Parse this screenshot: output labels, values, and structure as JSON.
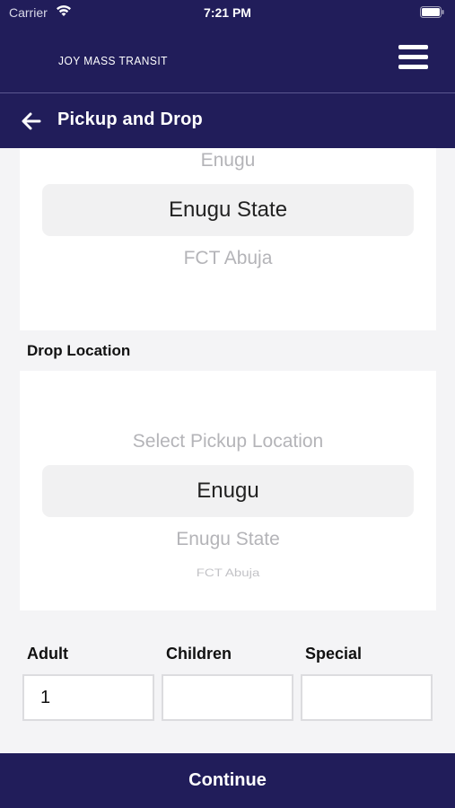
{
  "status_bar": {
    "carrier": "Carrier",
    "time": "7:21 PM",
    "wifi_icon": "wifi-icon",
    "battery_icon": "battery-icon"
  },
  "header": {
    "brand": "JOY MASS TRANSIT",
    "menu_icon": "hamburger-menu-icon",
    "title": "Pickup and Drop",
    "back_icon": "arrow-left-icon"
  },
  "pickup_picker": {
    "options_above": [
      "Enugu"
    ],
    "selected": "Enugu State",
    "options_below": [
      "FCT Abuja"
    ]
  },
  "drop": {
    "label": "Drop Location",
    "options_above": [
      "Select Pickup Location"
    ],
    "selected": "Enugu",
    "options_below": [
      "Enugu State",
      "FCT Abuja"
    ]
  },
  "passengers": {
    "adult": {
      "label": "Adult",
      "value": "1"
    },
    "children": {
      "label": "Children",
      "value": ""
    },
    "special": {
      "label": "Special",
      "value": ""
    }
  },
  "continue_label": "Continue",
  "colors": {
    "primary": "#211d5a",
    "background": "#f4f4f6",
    "card": "#ffffff"
  }
}
